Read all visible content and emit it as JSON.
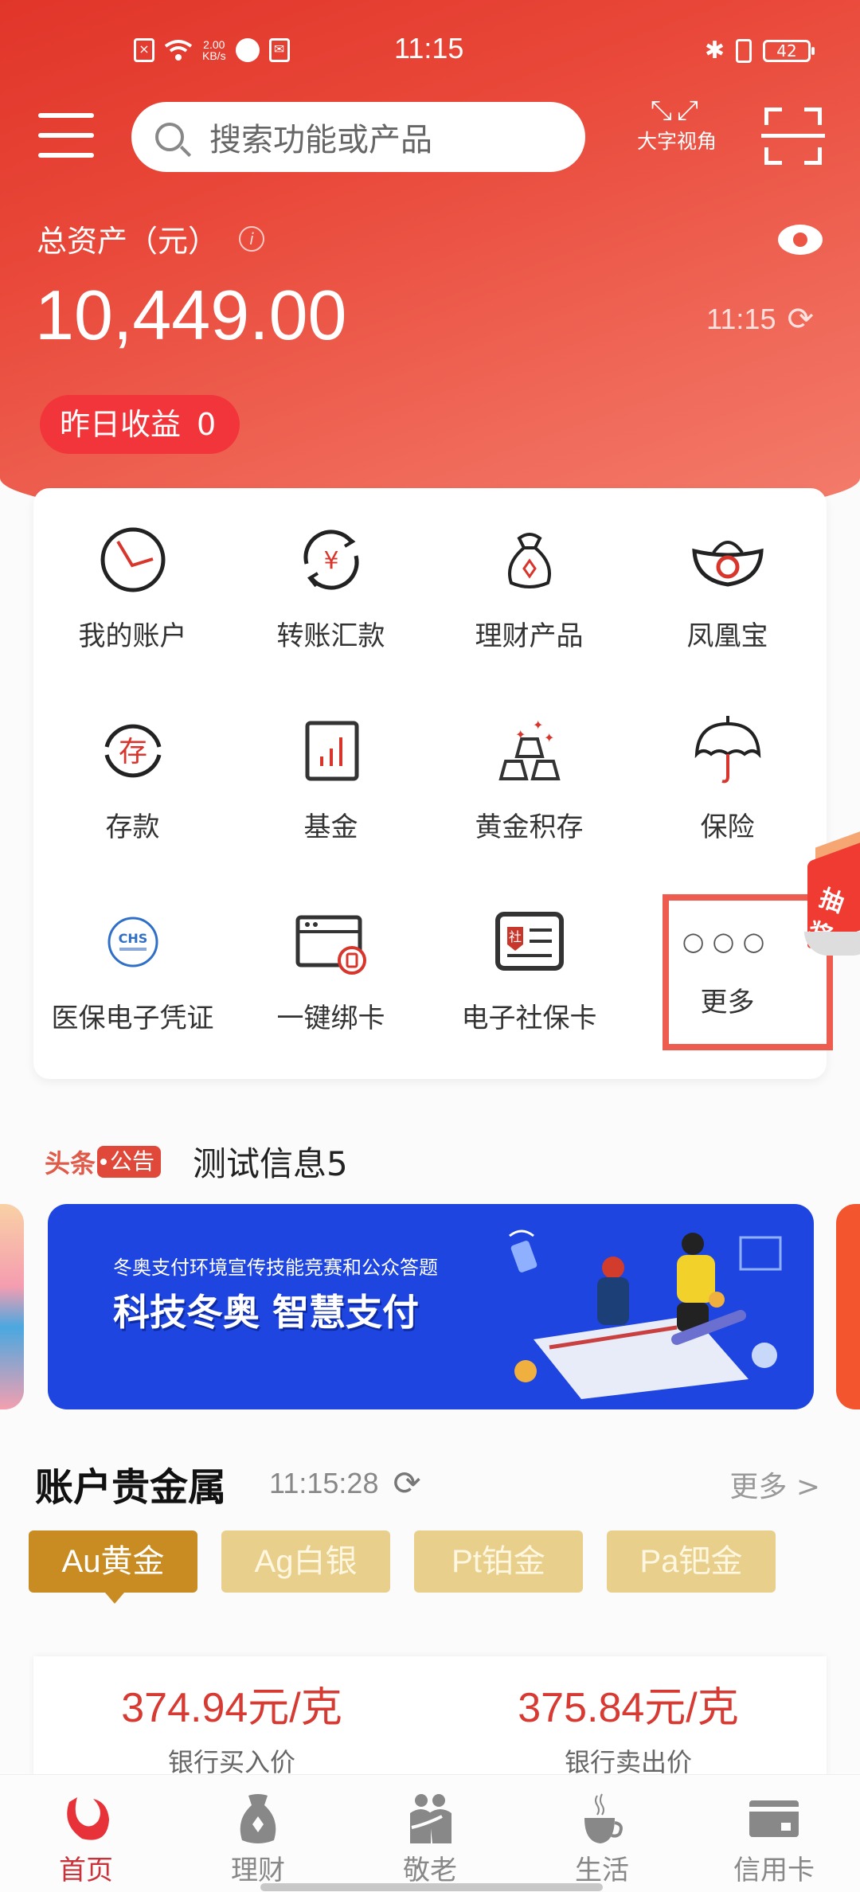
{
  "status_bar": {
    "time": "11:15",
    "net_speed_value": "2.00",
    "net_speed_unit": "KB/s",
    "battery": "42"
  },
  "header": {
    "search_placeholder": "搜索功能或产品",
    "big_font_label": "大字视角"
  },
  "assets": {
    "label": "总资产（元）",
    "amount": "10,449.00",
    "updated_time": "11:15",
    "yesterday_label": "昨日收益",
    "yesterday_value": "0"
  },
  "shortcuts": [
    {
      "label": "我的账户",
      "icon": "account-icon"
    },
    {
      "label": "转账汇款",
      "icon": "transfer-icon"
    },
    {
      "label": "理财产品",
      "icon": "money-bag-icon"
    },
    {
      "label": "凤凰宝",
      "icon": "ingot-icon"
    },
    {
      "label": "存款",
      "icon": "deposit-icon"
    },
    {
      "label": "基金",
      "icon": "fund-chart-icon"
    },
    {
      "label": "黄金积存",
      "icon": "gold-bars-icon"
    },
    {
      "label": "保险",
      "icon": "umbrella-icon"
    },
    {
      "label": "医保电子凭证",
      "icon": "chs-logo-icon"
    },
    {
      "label": "一键绑卡",
      "icon": "bind-card-icon"
    },
    {
      "label": "电子社保卡",
      "icon": "social-security-card-icon"
    },
    {
      "label": "更多",
      "icon": "more-dots-icon"
    }
  ],
  "promo_float": {
    "text": "抽奖"
  },
  "notice": {
    "tag_left": "头条",
    "tag_right": "公告",
    "message": "测试信息5"
  },
  "banner": {
    "subtitle": "冬奥支付环境宣传技能竞赛和公众答题",
    "title": "科技冬奥 智慧支付"
  },
  "precious_metals": {
    "title": "账户贵金属",
    "time": "11:15:28",
    "more_label": "更多 >",
    "tabs": [
      {
        "label": "Au黄金",
        "active": true
      },
      {
        "label": "Ag白银",
        "active": false
      },
      {
        "label": "Pt铂金",
        "active": false
      },
      {
        "label": "Pa钯金",
        "active": false
      }
    ],
    "buy_price": "374.94元/克",
    "buy_label": "银行买入价",
    "sell_price": "375.84元/克",
    "sell_label": "银行卖出价"
  },
  "tabbar": [
    {
      "label": "首页",
      "icon": "home-logo-icon",
      "active": true
    },
    {
      "label": "理财",
      "icon": "money-bag-icon",
      "active": false
    },
    {
      "label": "敬老",
      "icon": "elderly-icon",
      "active": false
    },
    {
      "label": "生活",
      "icon": "coffee-cup-icon",
      "active": false
    },
    {
      "label": "信用卡",
      "icon": "credit-card-icon",
      "active": false
    }
  ],
  "colors": {
    "brand_red": "#e1352a",
    "gold_active": "#c98c22",
    "gold_inactive": "#e9cf8c",
    "price_red": "#d63a32",
    "banner_blue": "#1f45e0"
  }
}
